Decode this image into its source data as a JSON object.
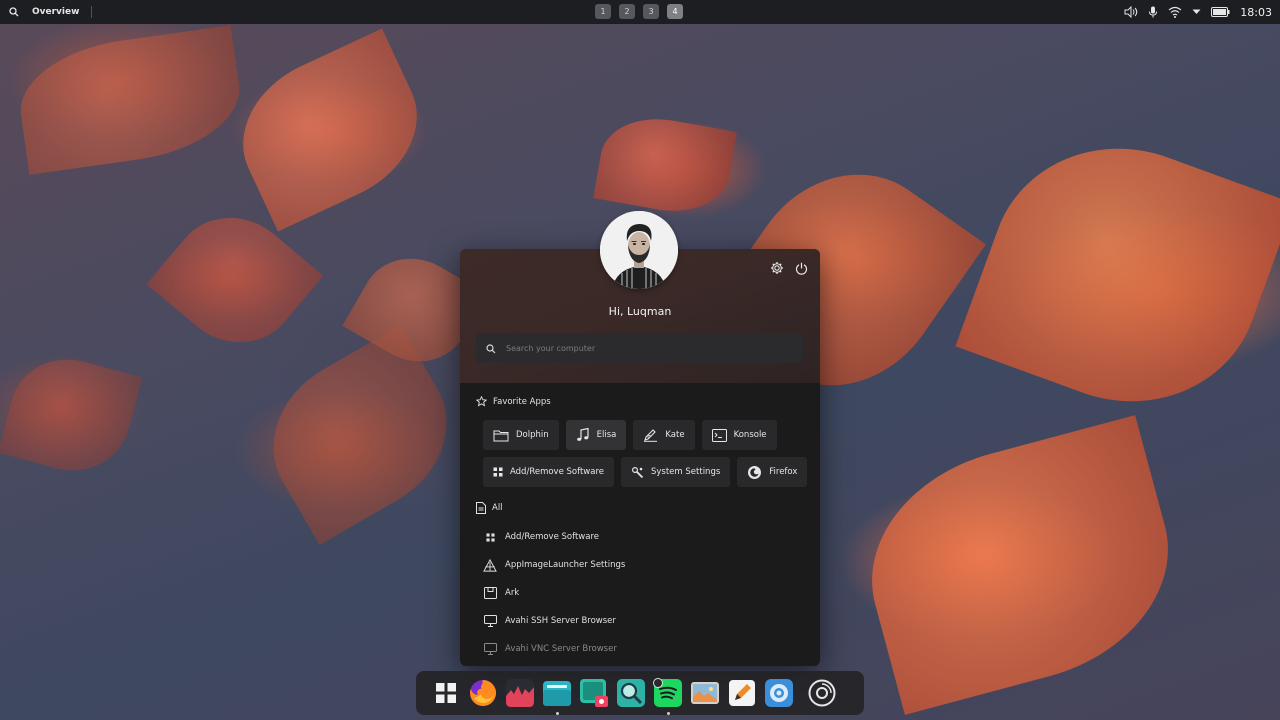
{
  "top_panel": {
    "overview_label": "Overview",
    "workspaces": [
      "1",
      "2",
      "3",
      "4"
    ],
    "active_workspace": "4",
    "clock": "18:03",
    "tray_icons": [
      "volume-icon",
      "microphone-icon",
      "wifi-icon",
      "dropdown-icon",
      "battery-icon"
    ]
  },
  "launcher": {
    "greeting": "Hi, Luqman",
    "search_placeholder": "Search your computer",
    "favorites_title": "Favorite Apps",
    "favorites": [
      {
        "label": "Dolphin",
        "icon": "folder-icon"
      },
      {
        "label": "Elisa",
        "icon": "music-note-icon"
      },
      {
        "label": "Kate",
        "icon": "pen-icon"
      },
      {
        "label": "Konsole",
        "icon": "terminal-icon"
      },
      {
        "label": "Add/Remove Software",
        "icon": "apps-grid-icon"
      },
      {
        "label": "System Settings",
        "icon": "settings-tools-icon"
      },
      {
        "label": "Firefox",
        "icon": "firefox-icon"
      }
    ],
    "all_title": "All",
    "all_apps": [
      {
        "label": "Add/Remove Software",
        "icon": "apps-grid-icon"
      },
      {
        "label": "AppImageLauncher Settings",
        "icon": "appimage-icon"
      },
      {
        "label": "Ark",
        "icon": "archive-icon"
      },
      {
        "label": "Avahi SSH Server Browser",
        "icon": "monitor-icon"
      },
      {
        "label": "Avahi VNC Server Browser",
        "icon": "monitor-icon"
      }
    ]
  },
  "dock": {
    "items": [
      "app-grid-icon",
      "firefox-icon",
      "audio-app-icon",
      "files-icon",
      "screenshot-icon",
      "search-app-icon",
      "spotify-icon",
      "image-viewer-icon",
      "text-editor-icon",
      "settings-icon",
      "disc-icon"
    ]
  },
  "colors": {
    "panel": "#1d1e22",
    "launcher_bg": "#1b1b1c",
    "launcher_head": "#3a2927",
    "button_bg": "#29292b"
  }
}
